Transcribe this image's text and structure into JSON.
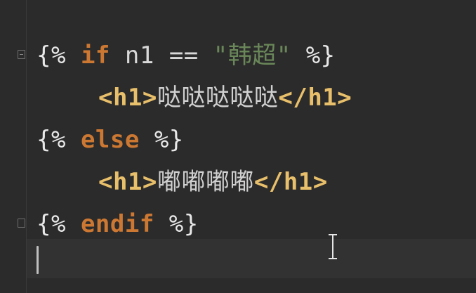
{
  "code": {
    "line1": {
      "open": "{%",
      "kw_if": "if",
      "var": "n1",
      "op": "==",
      "string": "\"韩超\"",
      "close": "%}"
    },
    "line2": {
      "open_tag": "<h1>",
      "text": "哒哒哒哒哒",
      "close_tag": "</h1>"
    },
    "line3": {
      "open": "{%",
      "kw_else": "else",
      "close": "%}"
    },
    "line4": {
      "open_tag": "<h1>",
      "text": "嘟嘟嘟嘟",
      "close_tag": "</h1>"
    },
    "line5": {
      "open": "{%",
      "kw_endif": "endif",
      "close": "%}"
    }
  },
  "colors": {
    "background": "#2b2b2b",
    "keyword": "#cc7832",
    "string": "#6a8759",
    "tag": "#e8bf6a"
  },
  "icons": [
    "fold-marker-icon",
    "text-cursor-icon"
  ]
}
